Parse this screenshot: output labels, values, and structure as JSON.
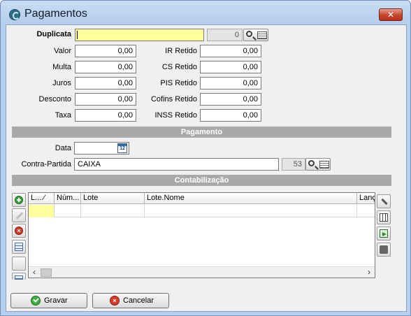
{
  "window": {
    "title": "Pagamentos",
    "close_glyph": "✕"
  },
  "duplicata": {
    "label": "Duplicata",
    "value": "",
    "number": "0"
  },
  "left_fields": [
    {
      "label": "Valor",
      "value": "0,00"
    },
    {
      "label": "Multa",
      "value": "0,00"
    },
    {
      "label": "Juros",
      "value": "0,00"
    },
    {
      "label": "Desconto",
      "value": "0,00"
    },
    {
      "label": "Taxa",
      "value": "0,00"
    }
  ],
  "right_fields": [
    {
      "label": "IR Retido",
      "value": "0,00"
    },
    {
      "label": "CS Retido",
      "value": "0,00"
    },
    {
      "label": "PIS Retido",
      "value": "0,00"
    },
    {
      "label": "Cofins Retido",
      "value": "0,00"
    },
    {
      "label": "INSS Retido",
      "value": "0,00"
    }
  ],
  "pagamento": {
    "section_title": "Pagamento",
    "data_label": "Data",
    "data_value": "",
    "calendar_icon_text": "12",
    "contra_label": "Contra-Partida",
    "contra_value": "CAIXA",
    "contra_code": "53"
  },
  "contabilizacao": {
    "section_title": "Contabilização",
    "columns": [
      "L... ⁄",
      "Núm...",
      "Lote",
      "Lote.Nome",
      "Lanç"
    ],
    "scroll_left": "‹",
    "scroll_right": "›"
  },
  "buttons": {
    "save": "Gravar",
    "cancel": "Cancelar"
  },
  "icons": {
    "app": "app-icon",
    "search": "search-icon",
    "list": "list-icon",
    "calendar": "calendar-icon",
    "add": "add-icon",
    "edit": "edit-icon",
    "delete": "delete-icon",
    "grid": "grid-icon",
    "tools": "tools-icon",
    "table": "table-icon",
    "export": "export-icon",
    "print": "print-icon"
  },
  "colors": {
    "required_field": "#ffff9e",
    "section_bar": "#a9a9a9",
    "close_button": "#c6452c"
  }
}
